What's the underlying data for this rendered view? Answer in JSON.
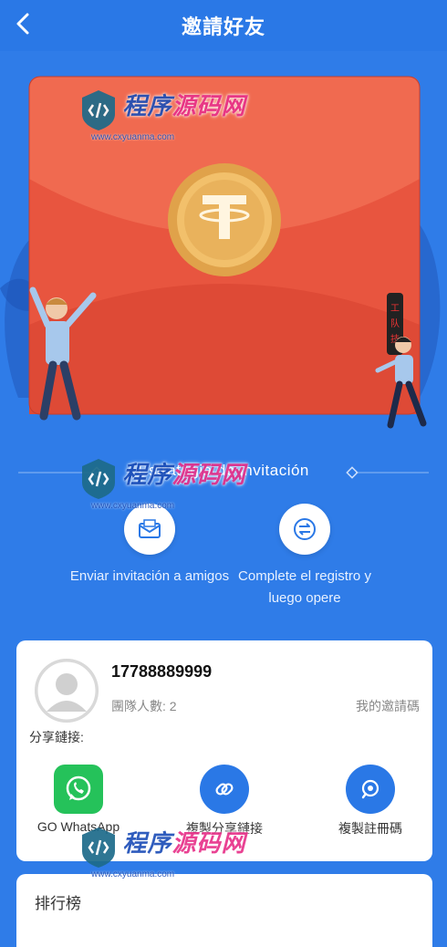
{
  "header": {
    "title": "邀請好友"
  },
  "strategy": {
    "label": "Estrategia de invitación"
  },
  "steps": [
    {
      "label": "Enviar invitación a amigos",
      "icon": "envelope-icon"
    },
    {
      "label": "Complete el registro y luego opere",
      "icon": "exchange-icon"
    }
  ],
  "user": {
    "phone": "17788889999",
    "team_label": "團隊人數: 2",
    "my_code_label": "我的邀請碼",
    "share_link_label": "分享鏈接:"
  },
  "actions": [
    {
      "label": "GO WhatsApp",
      "icon": "whatsapp-icon"
    },
    {
      "label": "複製分享鏈接",
      "icon": "link-icon"
    },
    {
      "label": "複製註冊碼",
      "icon": "search-code-icon"
    }
  ],
  "ranking": {
    "title": "排行榜"
  },
  "watermark": {
    "text_blue": "程序",
    "text_pink": "源码网",
    "url": "www.cxyuanma.com"
  },
  "colors": {
    "primary": "#2f7ce8",
    "envelope": "#e8553f",
    "coin": "#e9b25c",
    "whatsapp": "#25c25a"
  }
}
